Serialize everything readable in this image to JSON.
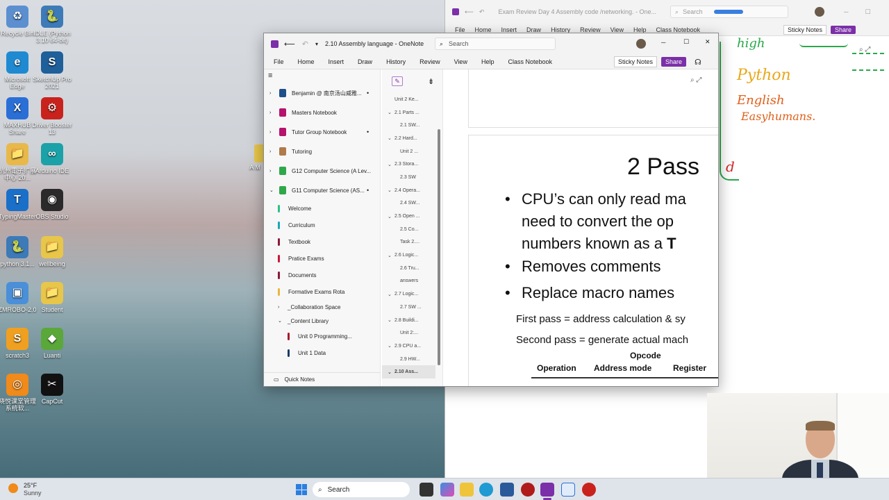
{
  "desktop": {
    "icons": [
      {
        "label": "Recycle Bin",
        "color": "#5b8fd0",
        "glyph": "♻"
      },
      {
        "label": "IDLE (Python 3.10 64-bit)",
        "color": "#3d7ab8",
        "glyph": "🐍"
      },
      {
        "label": "Microsoft Edge",
        "color": "#1f8ad2",
        "glyph": "e"
      },
      {
        "label": "SketchUp Pro 2021",
        "color": "#1f5f9a",
        "glyph": "S"
      },
      {
        "label": "MAXHUB Share",
        "color": "#2a6fd6",
        "glyph": "X"
      },
      {
        "label": "Driver Booster 13",
        "color": "#c9221c",
        "glyph": "⚙"
      },
      {
        "label": "杭州電子扩展中心 20...",
        "color": "#e8b94a",
        "glyph": "📁"
      },
      {
        "label": "Arduino IDE",
        "color": "#1aa2a8",
        "glyph": "∞"
      },
      {
        "label": "TypingMaster",
        "color": "#1a6fc8",
        "glyph": "T"
      },
      {
        "label": "OBS Studio",
        "color": "#2a2a2a",
        "glyph": "◉"
      },
      {
        "label": "python 3.1...",
        "color": "#3d7ab8",
        "glyph": "🐍"
      },
      {
        "label": "wellbeing",
        "color": "#e8c64a",
        "glyph": "📁"
      },
      {
        "label": "ZMROBO-2.0",
        "color": "#4a8fd8",
        "glyph": "▣"
      },
      {
        "label": "Student",
        "color": "#e8c64a",
        "glyph": "📁"
      },
      {
        "label": "scratch3",
        "color": "#f0a020",
        "glyph": "S"
      },
      {
        "label": "Luanti",
        "color": "#5aa83a",
        "glyph": "◆"
      },
      {
        "label": "晓悦课堂管理系统软...",
        "color": "#f08a1a",
        "glyph": "◎"
      },
      {
        "label": "CapCut",
        "color": "#111111",
        "glyph": "✂"
      }
    ],
    "partial_label": "A M"
  },
  "bg_window": {
    "title": "Exam Review Day 4 Assembly code /networking. - One...",
    "search": "Search",
    "menu": [
      "File",
      "Home",
      "Insert",
      "Draw",
      "History",
      "Review",
      "View",
      "Help",
      "Class Notebook"
    ],
    "sticky": "Sticky Notes",
    "share": "Share",
    "ink": {
      "line1": "high",
      "line2": "Python",
      "line3": "English",
      "line4": "Easyhumans.",
      "line5": "d"
    }
  },
  "window": {
    "title": "2.10 Assembly language - OneNote",
    "search_placeholder": "Search",
    "menu": [
      "File",
      "Home",
      "Insert",
      "Draw",
      "History",
      "Review",
      "View",
      "Help",
      "Class Notebook"
    ],
    "sticky": "Sticky Notes",
    "share": "Share",
    "notebooks": [
      {
        "label": "Benjamin @ 南京汤山威雅...",
        "color": "#1f4f8a",
        "dot": true
      },
      {
        "label": "Masters Notebook",
        "color": "#b5136d",
        "dot": false
      },
      {
        "label": "Tutor Group Notebook",
        "color": "#b5136d",
        "dot": true
      },
      {
        "label": "Tutoring",
        "color": "#b07a4a",
        "dot": false
      },
      {
        "label": "G12 Computer Science (A Lev...",
        "color": "#2fa84a",
        "dot": false
      },
      {
        "label": "G11 Computer Science (AS...",
        "color": "#2fa84a",
        "dot": true
      }
    ],
    "sections": [
      {
        "label": "Welcome",
        "color": "#2fbf8a"
      },
      {
        "label": "Curriculum",
        "color": "#1aa8b8"
      },
      {
        "label": "Textbook",
        "color": "#8a1a3a"
      },
      {
        "label": "Pratice Exams",
        "color": "#c8163a"
      },
      {
        "label": "Documents",
        "color": "#8a1a3a"
      },
      {
        "label": "Formative Exams Rota",
        "color": "#e8b83a"
      }
    ],
    "groups": [
      "_Collaboration Space",
      "_Content Library"
    ],
    "subsections": [
      {
        "label": "Unit 0 Programming...",
        "color": "#a81a2a"
      },
      {
        "label": "Unit 1 Data",
        "color": "#1a3a6a"
      }
    ],
    "quick_notes": "Quick Notes",
    "pages": [
      {
        "label": "Unit 2 Ke...",
        "indent": 0,
        "chev": false
      },
      {
        "label": "2.1 Parts ...",
        "indent": 0,
        "chev": true
      },
      {
        "label": "2.1 SW...",
        "indent": 1,
        "chev": false
      },
      {
        "label": "2.2 Hard...",
        "indent": 0,
        "chev": true
      },
      {
        "label": "Unit 2 ...",
        "indent": 1,
        "chev": false
      },
      {
        "label": "2.3 Stora...",
        "indent": 0,
        "chev": true
      },
      {
        "label": "2.3 SW",
        "indent": 1,
        "chev": false
      },
      {
        "label": "2.4 Opera...",
        "indent": 0,
        "chev": true
      },
      {
        "label": "2.4 SW...",
        "indent": 1,
        "chev": false
      },
      {
        "label": "2.5 Open ...",
        "indent": 0,
        "chev": true
      },
      {
        "label": "2.5 Co...",
        "indent": 1,
        "chev": false
      },
      {
        "label": "Task 2....",
        "indent": 1,
        "chev": false
      },
      {
        "label": "2.6 Logic...",
        "indent": 0,
        "chev": true
      },
      {
        "label": "2.6 Tru...",
        "indent": 1,
        "chev": false
      },
      {
        "label": "answers",
        "indent": 1,
        "chev": false
      },
      {
        "label": "2.7 Logic...",
        "indent": 0,
        "chev": true
      },
      {
        "label": "2.7 SW ...",
        "indent": 1,
        "chev": false
      },
      {
        "label": "2.8 Buildi...",
        "indent": 0,
        "chev": true
      },
      {
        "label": "Unit 2:...",
        "indent": 1,
        "chev": false
      },
      {
        "label": "2.9 CPU a...",
        "indent": 0,
        "chev": true
      },
      {
        "label": "2.9 HW...",
        "indent": 1,
        "chev": false
      },
      {
        "label": "2.10 Ass...",
        "indent": 0,
        "chev": true,
        "active": true
      }
    ],
    "slide": {
      "heading": "2 Pass",
      "bullet1a": "CPU’s can only read ma",
      "bullet1b": "need to convert the op",
      "bullet1c": "numbers known as a ",
      "bullet1c_bold": "T",
      "bullet2": "Removes comments",
      "bullet3": "Replace macro names",
      "pass1": "First pass = address calculation & sy",
      "pass2": "Second pass = generate actual mach",
      "opcode": "Opcode",
      "col_operation": "Operation",
      "col_address": "Address mode",
      "col_register": "Register"
    }
  },
  "taskbar": {
    "weather_temp": "25°F",
    "weather_cond": "Sunny",
    "search": "Search"
  }
}
